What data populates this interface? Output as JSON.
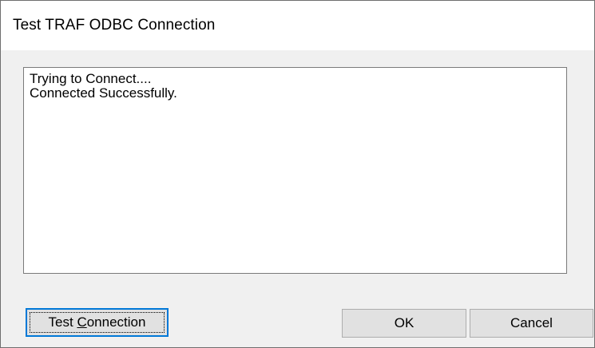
{
  "window": {
    "title": "Test TRAF ODBC Connection"
  },
  "output": {
    "lines": [
      "Trying to Connect....",
      "Connected Successfully."
    ]
  },
  "buttons": {
    "test_connection": {
      "prefix": "Test ",
      "mnemonic": "C",
      "suffix": "onnection"
    },
    "ok": "OK",
    "cancel": "Cancel"
  },
  "colors": {
    "dialog_bg": "#f0f0f0",
    "title_bg": "#ffffff",
    "focus_border": "#0078d7",
    "button_bg": "#e1e1e1"
  }
}
